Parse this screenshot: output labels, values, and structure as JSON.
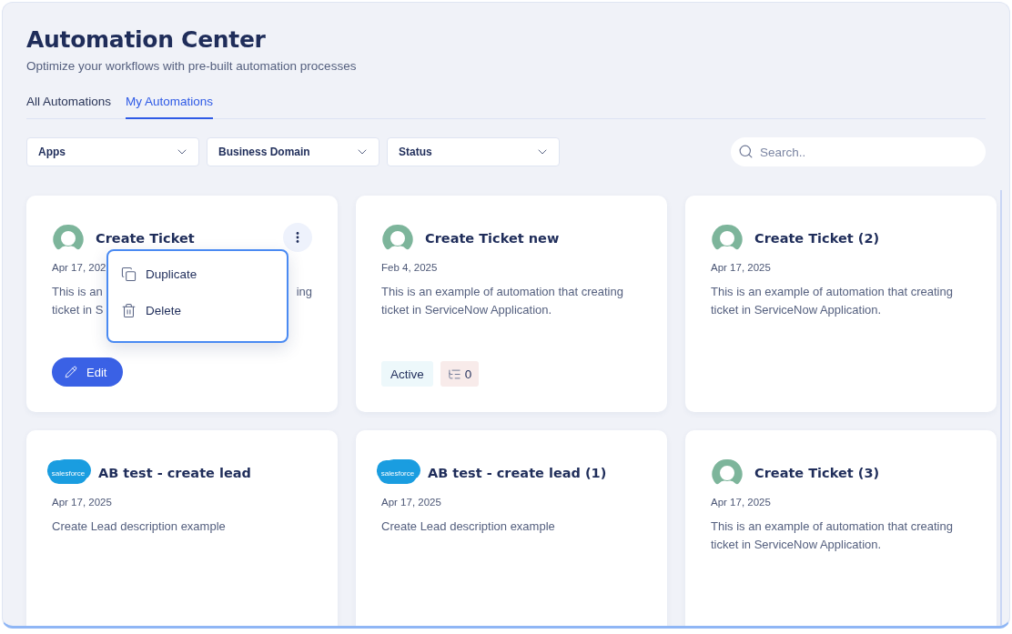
{
  "header": {
    "title": "Automation Center",
    "subtitle": "Optimize your workflows with pre-built automation processes"
  },
  "tabs": [
    {
      "label": "All Automations",
      "selected": false
    },
    {
      "label": "My Automations",
      "selected": true
    }
  ],
  "filters": [
    {
      "label": "Apps"
    },
    {
      "label": "Business Domain"
    },
    {
      "label": "Status"
    }
  ],
  "search": {
    "placeholder": "Search.."
  },
  "cards": [
    {
      "kind": "servicenow",
      "title": "Create Ticket",
      "date": "Apr 17, 202",
      "description_lines": [
        {
          "left": "This is an",
          "right": "ing"
        },
        {
          "left": "ticket in S"
        }
      ],
      "edit_button": "Edit",
      "menu": {
        "items": [
          {
            "label": "Duplicate"
          },
          {
            "label": "Delete"
          }
        ]
      }
    },
    {
      "kind": "servicenow",
      "title": "Create Ticket new",
      "date": "Feb 4, 2025",
      "description": "This is an example of automation that creating ticket in ServiceNow Application.",
      "status": "Active",
      "count": "0"
    },
    {
      "kind": "servicenow",
      "title": "Create Ticket (2)",
      "date": "Apr 17, 2025",
      "description": "This is an example of automation that creating ticket in ServiceNow Application."
    },
    {
      "kind": "salesforce",
      "logo_text": "salesforce",
      "title": "AB test - create lead",
      "date": "Apr 17, 2025",
      "description": "Create Lead description example"
    },
    {
      "kind": "salesforce",
      "logo_text": "salesforce",
      "title": "AB test - create lead (1)",
      "date": "Apr 17, 2025",
      "description": "Create Lead description example"
    },
    {
      "kind": "servicenow",
      "title": "Create Ticket (3)",
      "date": "Apr 17, 2025",
      "description": "This is an example of automation that creating ticket in ServiceNow Application."
    }
  ]
}
